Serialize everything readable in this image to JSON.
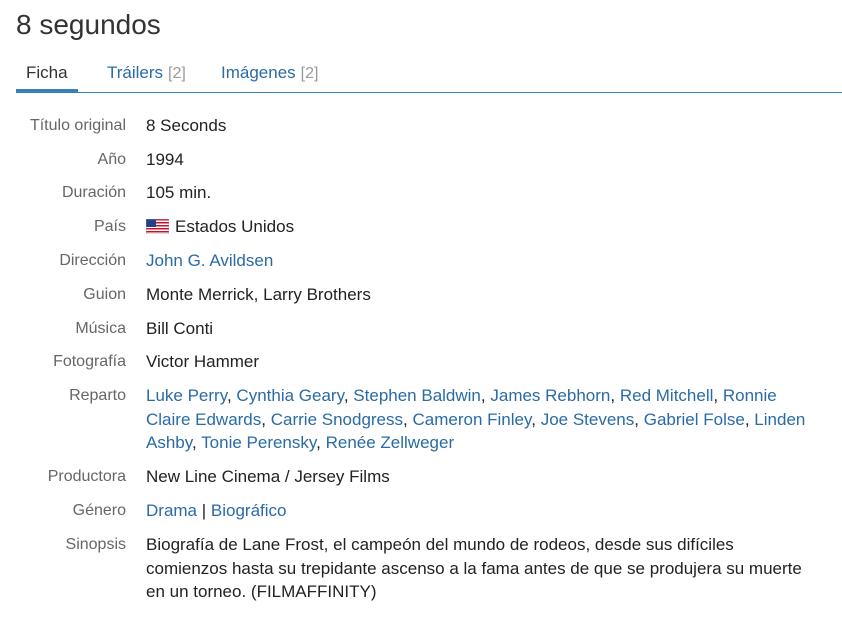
{
  "page_title": "8 segundos",
  "tabs": [
    {
      "label": "Ficha",
      "count": ""
    },
    {
      "label": "Tráilers",
      "count": "[2]"
    },
    {
      "label": "Imágenes",
      "count": "[2]"
    }
  ],
  "fields": {
    "titulo_original": {
      "label": "Título original",
      "value": "8 Seconds"
    },
    "anio": {
      "label": "Año",
      "value": "1994"
    },
    "duracion": {
      "label": "Duración",
      "value": "105 min."
    },
    "pais": {
      "label": "País",
      "value": "Estados Unidos",
      "flag_icon": "us-flag-icon"
    },
    "direccion": {
      "label": "Dirección",
      "value": "John G. Avildsen"
    },
    "guion": {
      "label": "Guion",
      "value": "Monte Merrick, Larry Brothers"
    },
    "musica": {
      "label": "Música",
      "value": "Bill Conti"
    },
    "fotografia": {
      "label": "Fotografía",
      "value": "Victor Hammer"
    },
    "reparto": {
      "label": "Reparto",
      "actors": [
        "Luke Perry",
        "Cynthia Geary",
        "Stephen Baldwin",
        "James Rebhorn",
        "Red Mitchell",
        "Ronnie Claire Edwards",
        "Carrie Snodgress",
        "Cameron Finley",
        "Joe Stevens",
        "Gabriel Folse",
        "Linden Ashby",
        "Tonie Perensky",
        "Renée Zellweger"
      ],
      "separator": ","
    },
    "productora": {
      "label": "Productora",
      "value": "New Line Cinema / Jersey Films"
    },
    "genero": {
      "label": "Género",
      "genres": [
        "Drama",
        "Biográfico"
      ],
      "separator": "|"
    },
    "sinopsis": {
      "label": "Sinopsis",
      "value": "Biografía de Lane Frost, el campeón del mundo de rodeos, desde sus difíciles comienzos hasta su trepidante ascenso a la fama antes de que se produjera su muerte en un torneo. (FILMAFFINITY)"
    }
  },
  "colors": {
    "link": "#2a6ba6",
    "label": "#666666",
    "tab_underline": "#3a7fb5"
  }
}
